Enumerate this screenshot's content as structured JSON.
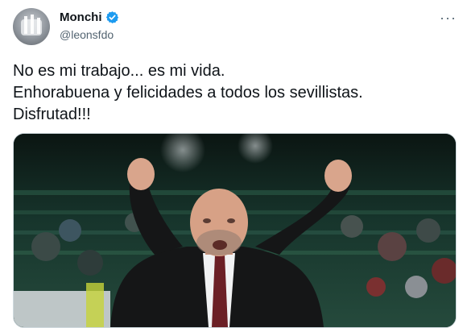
{
  "tweet": {
    "author_name": "Monchi",
    "author_handle": "@leonsfdo",
    "verified": true,
    "text_lines": [
      "No es mi trabajo... es mi vida.",
      "Enhorabuena y felicidades a todos los sevillistas.",
      "Disfrutad!!!"
    ],
    "more_icon": "more-options-icon",
    "verified_icon": "verified-badge-icon",
    "media_subject": "photo"
  },
  "colors": {
    "text": "#0f1419",
    "secondary_text": "#536471",
    "verified_blue": "#1d9bf0",
    "border": "#cfd9de"
  }
}
